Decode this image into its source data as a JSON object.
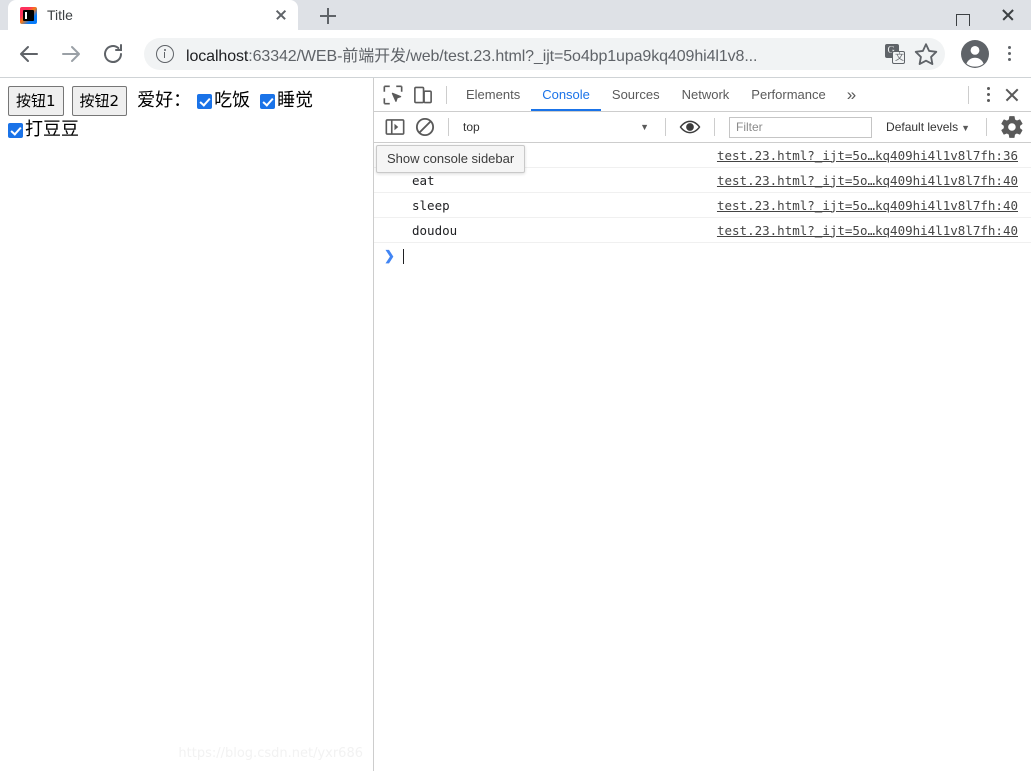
{
  "browser": {
    "tab": {
      "title": "Title",
      "favicon": "intellij-idea-icon",
      "close": "×"
    },
    "new_tab_label": "+",
    "window_controls": {
      "maximize": "maximize-icon",
      "close": "close-icon"
    },
    "nav": {
      "back": "back-arrow-icon",
      "forward": "forward-arrow-icon",
      "reload": "reload-icon"
    },
    "omnibox": {
      "info_icon": "info-circle-icon",
      "url_prefix": "localhost",
      "url_rest": ":63342/WEB-前端开发/web/test.23.html?_ijt=5o4bp1upa9kq409hi4l1v8...",
      "translate_icon": "translate-icon",
      "translate_glyph_a": "G",
      "translate_glyph_b": "文",
      "star_icon": "bookmark-star-icon"
    },
    "profile_icon": "account-avatar-icon",
    "menu_icon": "chrome-menu-icon"
  },
  "page": {
    "buttons": [
      {
        "label": "按钮1"
      },
      {
        "label": "按钮2"
      }
    ],
    "hobby_label": "爱好：",
    "checkboxes": [
      {
        "label": "吃饭",
        "checked": true
      },
      {
        "label": "睡觉",
        "checked": true
      },
      {
        "label": "打豆豆",
        "checked": true
      }
    ],
    "checkbox_color": "#1a73e8",
    "watermark": "https://blog.csdn.net/yxr686"
  },
  "devtools": {
    "inspect_icon": "inspect-element-icon",
    "device_icon": "device-toolbar-icon",
    "tabs": [
      {
        "label": "Elements",
        "active": false
      },
      {
        "label": "Console",
        "active": true
      },
      {
        "label": "Sources",
        "active": false
      },
      {
        "label": "Network",
        "active": false
      },
      {
        "label": "Performance",
        "active": false
      }
    ],
    "more_tabs": "»",
    "kebab_icon": "devtools-menu-icon",
    "close_icon": "devtools-close-icon",
    "accent_color": "#1a73e8",
    "console_toolbar": {
      "sidebar_toggle_icon": "console-sidebar-toggle-icon",
      "clear_icon": "clear-console-icon",
      "context_value": "top",
      "context_caret": "▼",
      "live_expression_icon": "eye-icon",
      "filter_placeholder": "Filter",
      "filter_value": "",
      "levels_label": "Default levels",
      "levels_caret": "▼",
      "settings_icon": "gear-icon"
    },
    "tooltip": {
      "text": "Show console sidebar"
    },
    "messages": [
      {
        "text": "",
        "source": "test.23.html?_ijt=5o…kq409hi4l1v8l7fh:36"
      },
      {
        "text": "eat",
        "source": "test.23.html?_ijt=5o…kq409hi4l1v8l7fh:40"
      },
      {
        "text": "sleep",
        "source": "test.23.html?_ijt=5o…kq409hi4l1v8l7fh:40"
      },
      {
        "text": "doudou",
        "source": "test.23.html?_ijt=5o…kq409hi4l1v8l7fh:40"
      }
    ],
    "prompt": {
      "caret": "❯",
      "value": ""
    }
  }
}
